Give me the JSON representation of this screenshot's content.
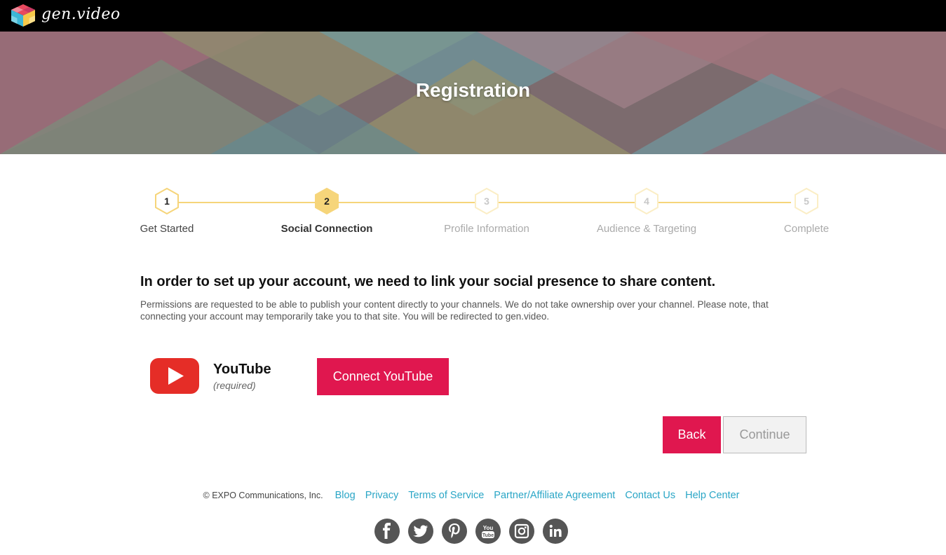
{
  "brand": {
    "name": "gen.video"
  },
  "hero": {
    "title": "Registration"
  },
  "steps": [
    {
      "number": "1",
      "label": "Get Started",
      "state": "done"
    },
    {
      "number": "2",
      "label": "Social Connection",
      "state": "active"
    },
    {
      "number": "3",
      "label": "Profile Information",
      "state": "todo"
    },
    {
      "number": "4",
      "label": "Audience & Targeting",
      "state": "todo"
    },
    {
      "number": "5",
      "label": "Complete",
      "state": "todo"
    }
  ],
  "main": {
    "heading": "In order to set up your account, we need to link your social presence to share content.",
    "note": "Permissions are requested to be able to publish your content directly to your channels. We do not take ownership over your channel. Please note, that connecting your account may temporarily take you to that site. You will be redirected to gen.video.",
    "youtube": {
      "name": "YouTube",
      "required": "(required)",
      "connect_label": "Connect YouTube"
    },
    "back_label": "Back",
    "continue_label": "Continue"
  },
  "footer": {
    "copyright": "EXPO Communications, Inc.",
    "links": [
      "Blog",
      "Privacy",
      "Terms of Service",
      "Partner/Affiliate Agreement",
      "Contact Us",
      "Help Center"
    ],
    "social_icons": [
      "facebook-icon",
      "twitter-icon",
      "pinterest-icon",
      "youtube-icon",
      "instagram-icon",
      "linkedin-icon"
    ]
  },
  "colors": {
    "accent": "#e0174f",
    "step_yellow": "#f6d57a",
    "link": "#2aa6c6",
    "topbar": "#000000"
  }
}
